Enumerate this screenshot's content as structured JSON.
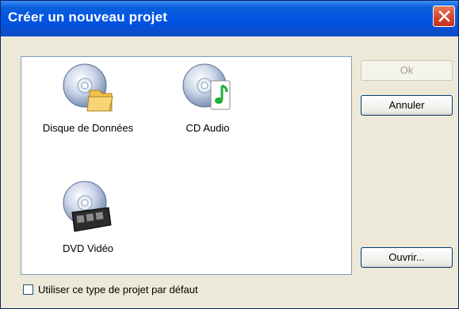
{
  "window": {
    "title": "Créer un nouveau projet"
  },
  "projects": [
    {
      "label": "Disque de Données",
      "icon": "data-disc-icon"
    },
    {
      "label": "CD Audio",
      "icon": "audio-cd-icon"
    },
    {
      "label": "DVD Vidéo",
      "icon": "dvd-video-icon"
    }
  ],
  "buttons": {
    "ok": "Ok",
    "cancel": "Annuler",
    "open": "Ouvrir..."
  },
  "checkbox": {
    "label": "Utiliser ce type de projet par défaut",
    "checked": false
  },
  "colors": {
    "titlebar": "#0054e3",
    "close": "#d1432a",
    "dialog_bg": "#ece9d8"
  }
}
